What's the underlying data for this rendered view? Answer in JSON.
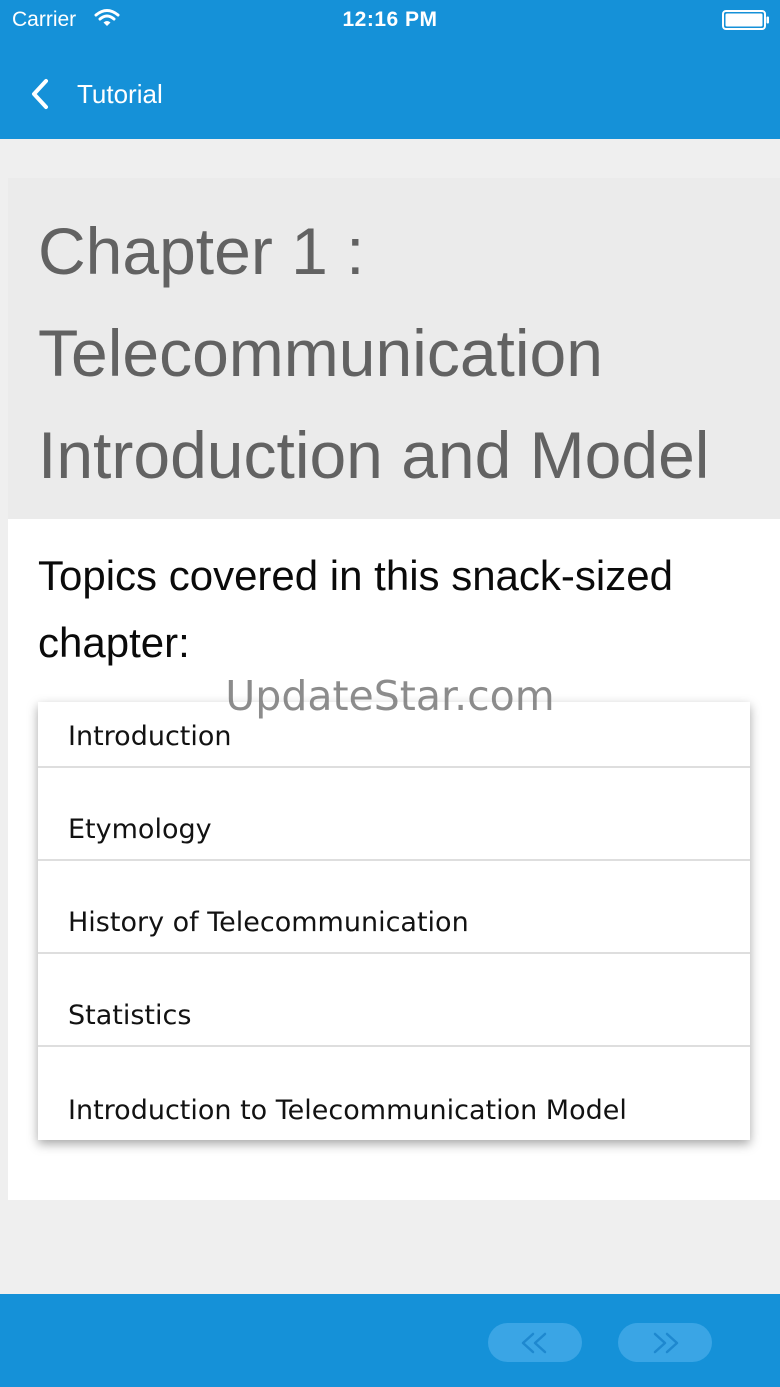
{
  "status_bar": {
    "carrier": "Carrier",
    "time": "12:16 PM"
  },
  "nav": {
    "back_label": "Tutorial"
  },
  "chapter": {
    "title": "Chapter 1 :\nTelecommunication\nIntroduction and Model",
    "topics_heading": "Topics covered in this snack-sized chapter:",
    "topics": [
      {
        "label": "Introduction"
      },
      {
        "label": "Etymology"
      },
      {
        "label": "History of Telecommunication"
      },
      {
        "label": "Statistics"
      },
      {
        "label": "Introduction to Telecommunication Model"
      }
    ]
  },
  "watermark": "UpdateStar.com",
  "icons": {
    "back": "chevron-left-icon",
    "wifi": "wifi-icon",
    "battery": "battery-icon",
    "prev": "double-chevron-left-icon",
    "next": "double-chevron-right-icon"
  },
  "colors": {
    "primary": "#1591d8",
    "button": "#3aa5e5",
    "header_bg": "#ebebeb",
    "title_text": "#626262"
  }
}
